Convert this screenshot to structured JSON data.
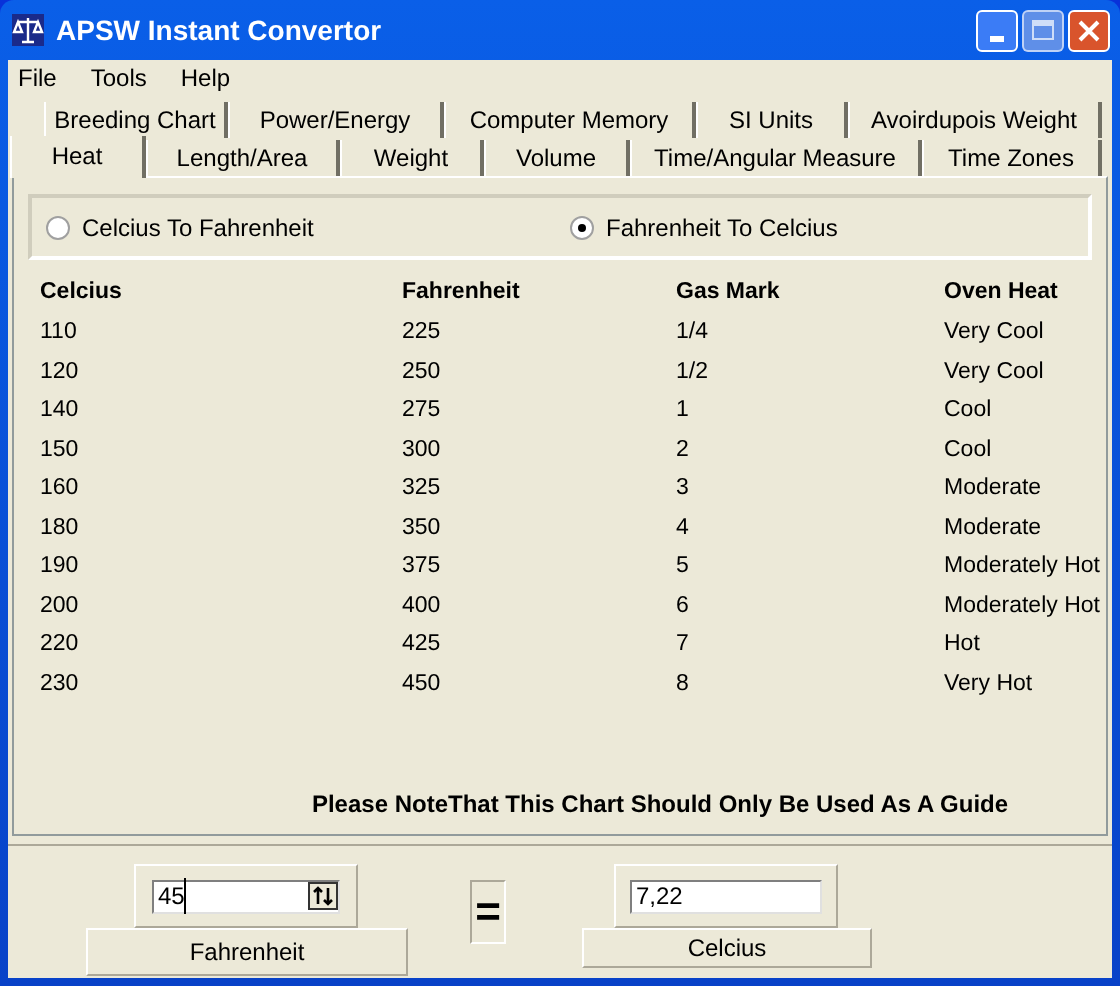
{
  "window": {
    "title": "APSW Instant Convertor"
  },
  "menu": [
    "File",
    "Tools",
    "Help"
  ],
  "tab_rows": [
    [
      {
        "label": "Breeding Chart",
        "selected": false
      },
      {
        "label": "Power/Energy",
        "selected": false
      },
      {
        "label": "Computer Memory",
        "selected": false
      },
      {
        "label": "SI Units",
        "selected": false
      },
      {
        "label": "Avoirdupois Weight",
        "selected": false
      }
    ],
    [
      {
        "label": "Heat",
        "selected": true
      },
      {
        "label": "Length/Area",
        "selected": false
      },
      {
        "label": "Weight",
        "selected": false
      },
      {
        "label": "Volume",
        "selected": false
      },
      {
        "label": "Time/Angular Measure",
        "selected": false
      },
      {
        "label": "Time Zones",
        "selected": false
      }
    ]
  ],
  "direction": [
    {
      "label": "Celcius To Fahrenheit",
      "selected": false
    },
    {
      "label": "Fahrenheit To Celcius",
      "selected": true
    }
  ],
  "table": {
    "columns": [
      "Celcius",
      "Fahrenheit",
      "Gas Mark",
      "Oven Heat"
    ],
    "rows": [
      [
        "110",
        "225",
        "1/4",
        "Very Cool"
      ],
      [
        "120",
        "250",
        "1/2",
        "Very Cool"
      ],
      [
        "140",
        "275",
        "1",
        "Cool"
      ],
      [
        "150",
        "300",
        "2",
        "Cool"
      ],
      [
        "160",
        "325",
        "3",
        "Moderate"
      ],
      [
        "180",
        "350",
        "4",
        "Moderate"
      ],
      [
        "190",
        "375",
        "5",
        "Moderately Hot"
      ],
      [
        "200",
        "400",
        "6",
        "Moderately Hot"
      ],
      [
        "220",
        "425",
        "7",
        "Hot"
      ],
      [
        "230",
        "450",
        "8",
        "Very Hot"
      ]
    ]
  },
  "note": "Please NoteThat This Chart Should Only Be Used As A Guide",
  "converter": {
    "input_value": "45",
    "from_unit": "Fahrenheit",
    "equals": "=",
    "output_value": "7,22",
    "to_unit": "Celcius"
  }
}
